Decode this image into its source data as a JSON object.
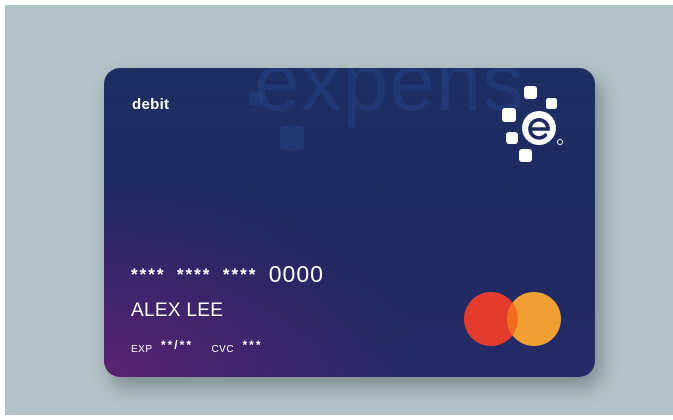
{
  "card": {
    "type_label": "debit",
    "watermark_text": "expens",
    "number_masked": [
      "****",
      "****",
      "****"
    ],
    "number_last4": "0000",
    "holder_name": "ALEX LEE",
    "exp_label": "EXP",
    "exp_value": "**/**",
    "cvc_label": "CVC",
    "cvc_value": "***"
  },
  "icons": {
    "brand_logo": "expensify-logo-icon",
    "network_logo": "mastercard-logo-icon"
  },
  "colors": {
    "background": "#b2c2c6",
    "card_top": "#1d2e62",
    "card_glow": "#5b2470",
    "mastercard_red": "#e33c2e",
    "mastercard_yellow": "#f0a033",
    "mastercard_overlap": "#f26b21"
  }
}
